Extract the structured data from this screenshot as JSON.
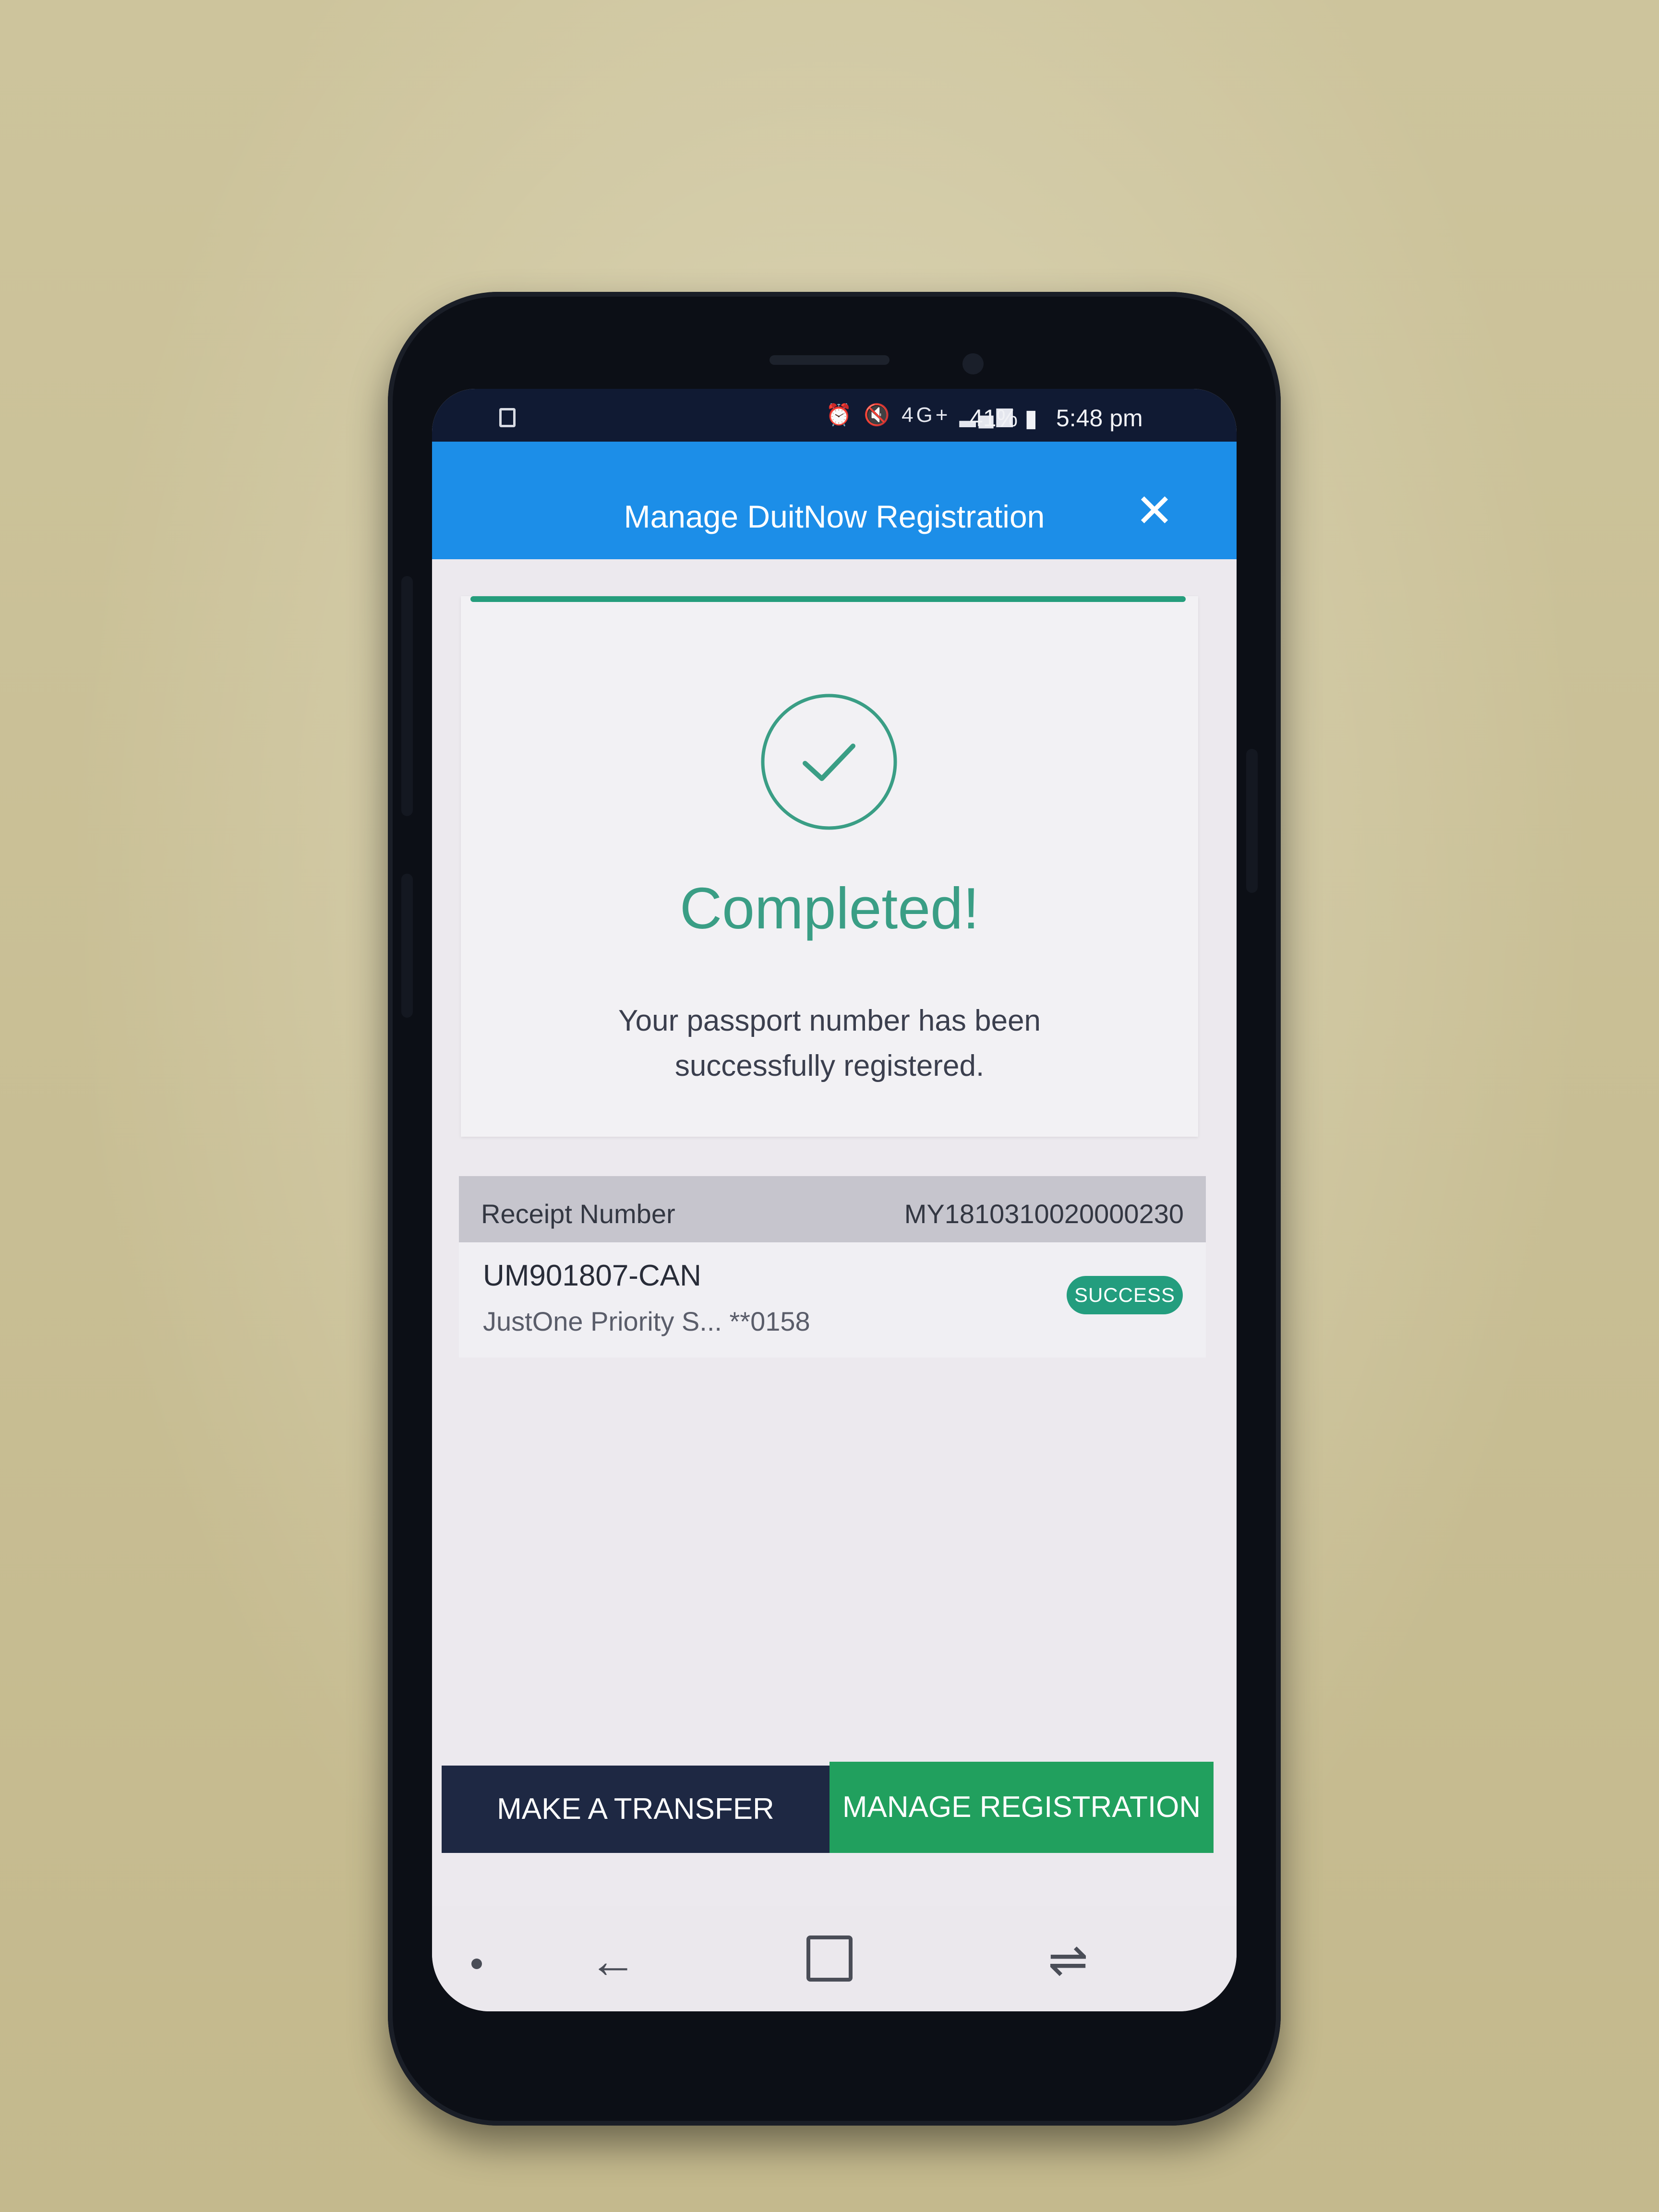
{
  "status_bar": {
    "battery_percent": "41%",
    "time": "5:48 pm",
    "signal": "4G+"
  },
  "app_bar": {
    "title": "Manage DuitNow Registration",
    "close_icon": "close-icon"
  },
  "result": {
    "heading": "Completed!",
    "message": "Your passport number has been successfully registered.",
    "accent_color": "#3a9e85",
    "icon": "check-circle-icon"
  },
  "receipt": {
    "label": "Receipt Number",
    "number": "MY1810310020000230",
    "id": "UM901807-CAN",
    "account": "JustOne Priority S... **0158",
    "status": "SUCCESS"
  },
  "actions": {
    "transfer_label": "MAKE A TRANSFER",
    "manage_label": "MANAGE REGISTRATION"
  },
  "colors": {
    "app_bar": "#1c8ee8",
    "primary_dark": "#1e2843",
    "success_green": "#21a05e"
  }
}
